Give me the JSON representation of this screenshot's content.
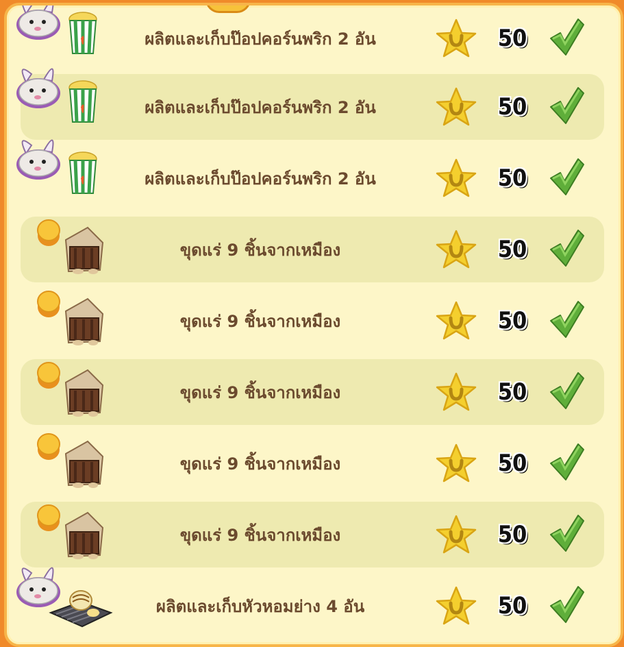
{
  "tasks": [
    {
      "label": "ผลิตและเก็บป๊อปคอร์นพริก 2 อัน",
      "reward": "50",
      "icon": "rabbit-popcorn",
      "done": true
    },
    {
      "label": "ผลิตและเก็บป๊อปคอร์นพริก 2 อัน",
      "reward": "50",
      "icon": "rabbit-popcorn",
      "done": true
    },
    {
      "label": "ผลิตและเก็บป๊อปคอร์นพริก 2 อัน",
      "reward": "50",
      "icon": "rabbit-popcorn",
      "done": true
    },
    {
      "label": "ขุดแร่ 9 ชิ้นจากเหมือง",
      "reward": "50",
      "icon": "coin-mine",
      "done": true
    },
    {
      "label": "ขุดแร่ 9 ชิ้นจากเหมือง",
      "reward": "50",
      "icon": "coin-mine",
      "done": true
    },
    {
      "label": "ขุดแร่ 9 ชิ้นจากเหมือง",
      "reward": "50",
      "icon": "coin-mine",
      "done": true
    },
    {
      "label": "ขุดแร่ 9 ชิ้นจากเหมือง",
      "reward": "50",
      "icon": "coin-mine",
      "done": true
    },
    {
      "label": "ขุดแร่ 9 ชิ้นจากเหมือง",
      "reward": "50",
      "icon": "coin-mine",
      "done": true
    },
    {
      "label": "ผลิตและเก็บหัวหอมย่าง 4 อัน",
      "reward": "50",
      "icon": "rabbit-grill",
      "done": true
    }
  ],
  "colors": {
    "frame": "#f08a2a",
    "panel": "#fdf6c8",
    "row_alt": "#eeeab0",
    "text": "#6b4a2e",
    "check": "#5fae3a",
    "star": "#f4cf2e"
  }
}
